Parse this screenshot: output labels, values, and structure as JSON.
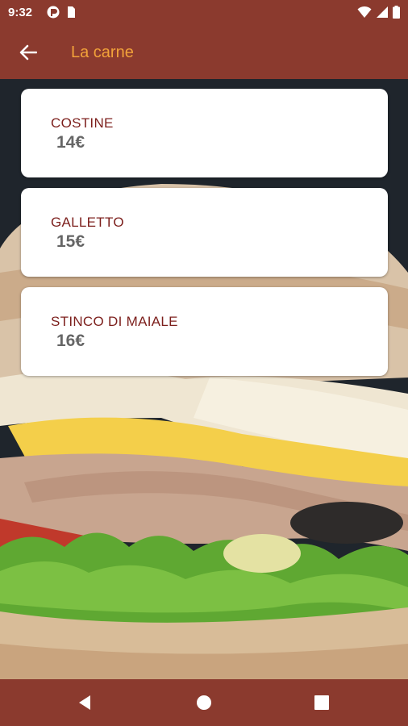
{
  "status_bar": {
    "time": "9:32"
  },
  "app_bar": {
    "title": "La carne",
    "title_color": "#f2a23a",
    "bar_color": "#8b3a2e"
  },
  "menu_items": [
    {
      "name": "COSTINE",
      "price": "14€"
    },
    {
      "name": "GALLETTO",
      "price": "15€"
    },
    {
      "name": "STINCO DI MAIALE",
      "price": "16€"
    }
  ],
  "icons": {
    "back": "arrow-back-icon",
    "nav_back": "triangle-back-icon",
    "nav_home": "circle-home-icon",
    "nav_recents": "square-recents-icon"
  }
}
